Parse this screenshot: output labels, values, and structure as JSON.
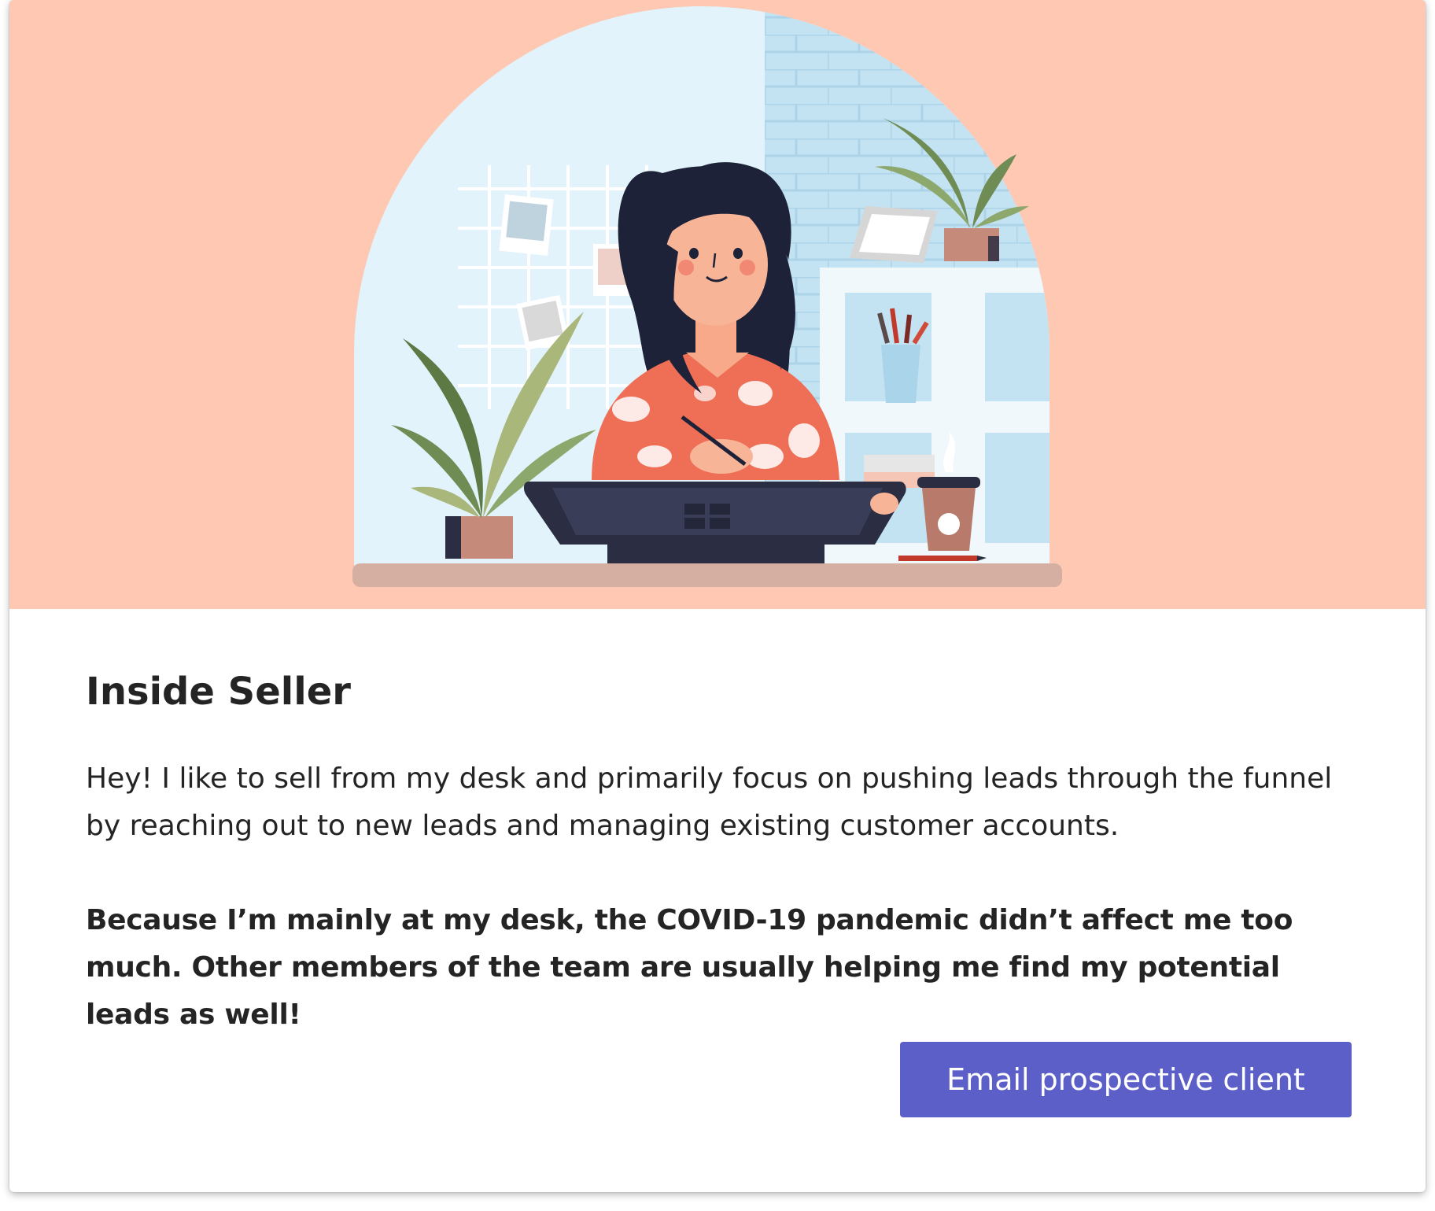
{
  "card": {
    "title": "Inside Seller",
    "intro": "Hey! I like to sell from my desk and primarily focus on pushing leads through the funnel by reaching out to new leads and managing existing customer accounts.",
    "note": "Because I’m mainly at my desk, the COVID-19 pandemic didn’t affect me too much. Other members of the team are usually helping me find my potential leads as well!",
    "action_label": "Email prospective client"
  },
  "colors": {
    "hero_background": "#fec8b3",
    "accent": "#5b5fc7"
  }
}
